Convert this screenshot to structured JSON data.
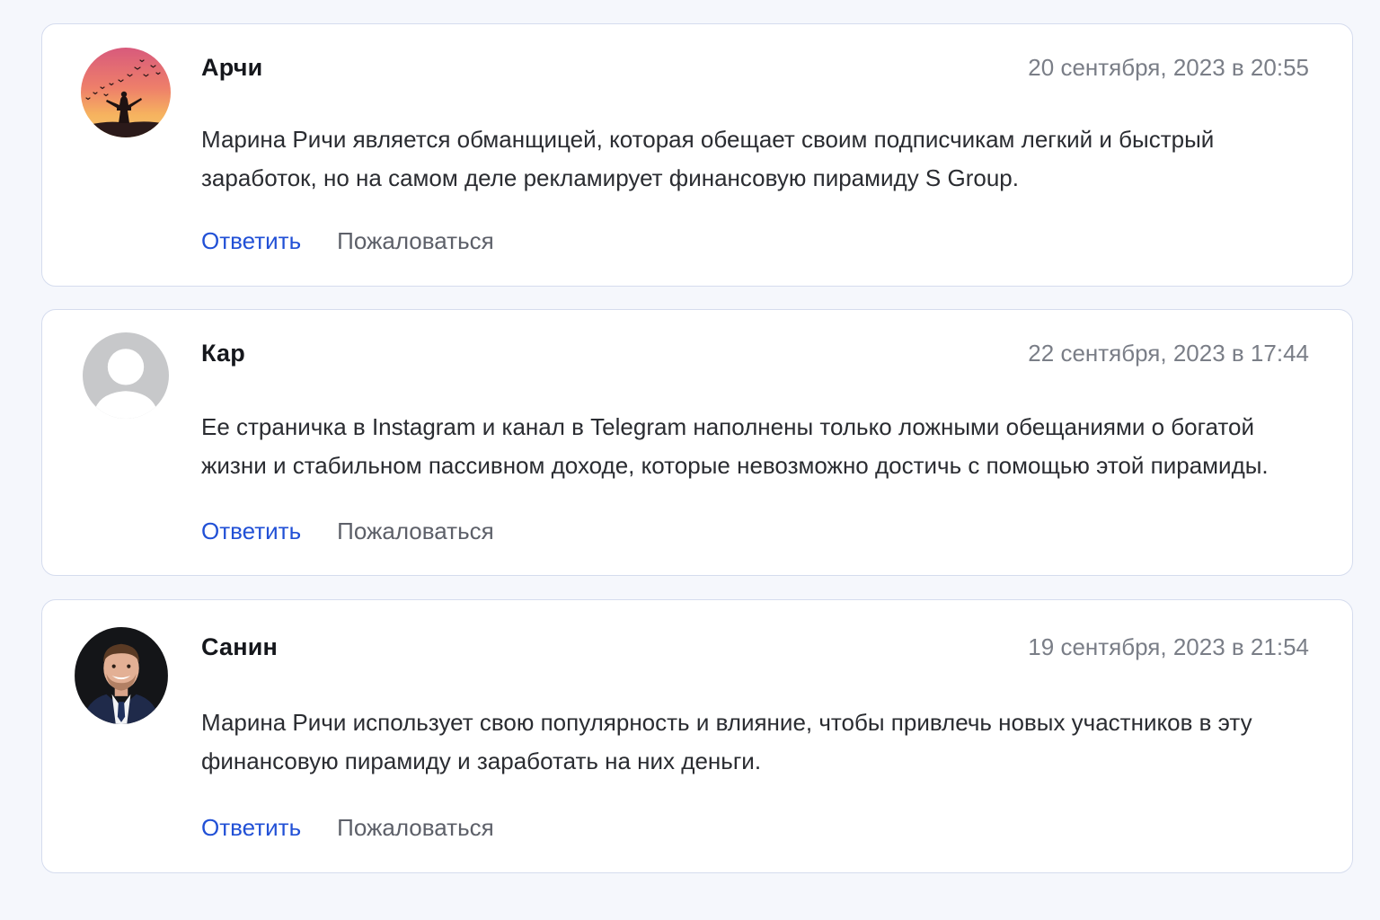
{
  "colors": {
    "page_background": "#f5f7fc",
    "card_border": "#d5dcee",
    "reply_link": "#2150d6",
    "complain_link": "#5d6069",
    "date_text": "#7a7e87"
  },
  "comments": [
    {
      "author": "Арчи",
      "date": "20 сентября, 2023 в 20:55",
      "text": "Марина Ричи является обманщицей, которая обещает своим подписчикам легкий и быстрый заработок, но на самом деле рекламирует финансовую пирамиду S Group.",
      "avatar": "sunset-silhouette-icon",
      "reply_label": "Ответить",
      "complain_label": "Пожаловаться"
    },
    {
      "author": "Кар",
      "date": "22 сентября, 2023 в 17:44",
      "text": "Ее страничка в Instagram и канал в Telegram наполнены только ложными обещаниями о богатой жизни и стабильном пассивном доходе, которые невозможно достичь с помощью этой пирамиды.",
      "avatar": "default-user-icon",
      "reply_label": "Ответить",
      "complain_label": "Пожаловаться"
    },
    {
      "author": "Санин",
      "date": "19 сентября, 2023 в 21:54",
      "text": "Марина Ричи использует свою популярность и влияние, чтобы привлечь новых участников в эту финансовую пирамиду и заработать на них деньги.",
      "avatar": "man-in-suit-icon",
      "reply_label": "Ответить",
      "complain_label": "Пожаловаться"
    }
  ]
}
